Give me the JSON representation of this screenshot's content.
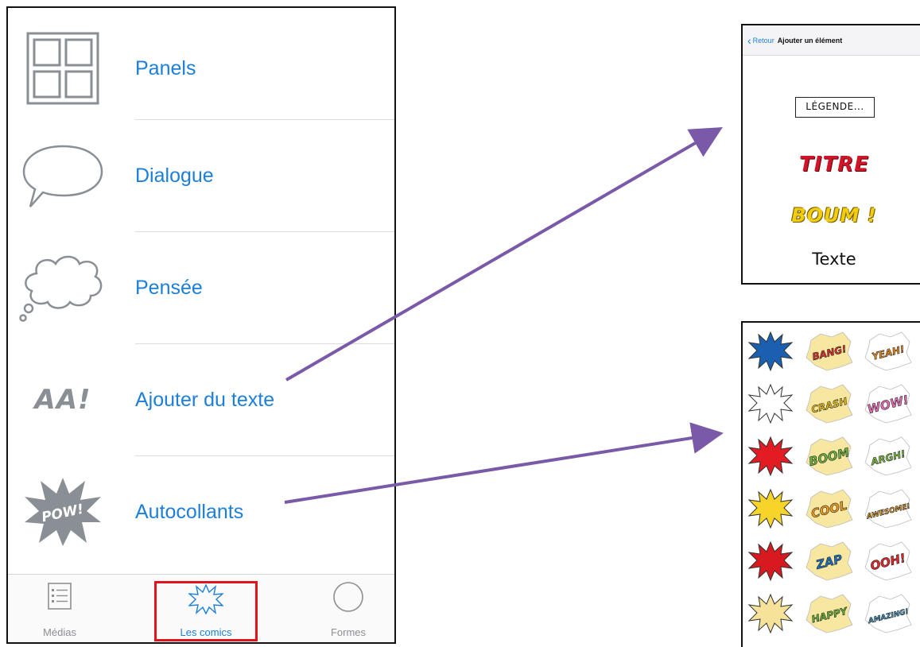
{
  "menu": {
    "items": [
      {
        "label": "Panels",
        "icon": "panels-icon"
      },
      {
        "label": "Dialogue",
        "icon": "speech-bubble-icon"
      },
      {
        "label": "Pensée",
        "icon": "thought-bubble-icon"
      },
      {
        "label": "Ajouter du texte",
        "icon": "add-text-icon",
        "icon_text": "AA!"
      },
      {
        "label": "Autocollants",
        "icon": "sticker-icon",
        "icon_text": "POW!"
      }
    ]
  },
  "tabbar": {
    "tabs": [
      {
        "label": "Médias",
        "icon": "media-list-icon"
      },
      {
        "label": "Les comics",
        "icon": "comic-burst-icon",
        "selected": true
      },
      {
        "label": "Formes",
        "icon": "circle-shape-icon"
      }
    ]
  },
  "text_panel": {
    "back_label": "Retour",
    "title": "Ajouter un élément",
    "options": {
      "legende": "LÉGENDE...",
      "titre": "TITRE",
      "boum": "BOUM !",
      "texte": "Texte"
    }
  },
  "sticker_panel": {
    "stickers": [
      {
        "text": "",
        "color": "#1b5fb0"
      },
      {
        "text": "BANG!",
        "color": "#e8302a"
      },
      {
        "text": "YEAH!",
        "color": "#f08a1c"
      },
      {
        "text": "",
        "color": "#ffffff"
      },
      {
        "text": "CRASH",
        "color": "#f0c61a"
      },
      {
        "text": "WOW!",
        "color": "#e96bb8"
      },
      {
        "text": "",
        "color": "#e31b23"
      },
      {
        "text": "BOOM",
        "color": "#6cb33f"
      },
      {
        "text": "ARGH!",
        "color": "#7cc041"
      },
      {
        "text": "",
        "color": "#f7d42a"
      },
      {
        "text": "COOL",
        "color": "#f29b1f"
      },
      {
        "text": "AWESOME!",
        "color": "#f3a11f"
      },
      {
        "text": "",
        "color": "#d71920"
      },
      {
        "text": "ZAP",
        "color": "#1c6fc1"
      },
      {
        "text": "OOH!",
        "color": "#e2262c"
      },
      {
        "text": "",
        "color": "#f7e29a"
      },
      {
        "text": "HAPPY",
        "color": "#68b53a"
      },
      {
        "text": "AMAZING!",
        "color": "#4aa2dc"
      }
    ]
  },
  "colors": {
    "link_blue": "#1c7fd9",
    "icon_gray": "#8a8f96",
    "arrow_purple": "#7a5aa8",
    "highlight_red": "#e0141c"
  }
}
